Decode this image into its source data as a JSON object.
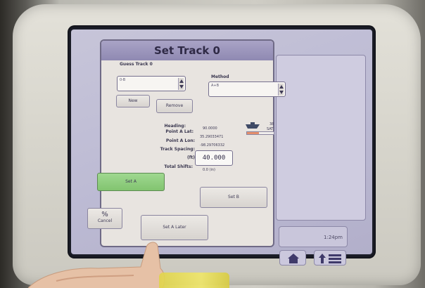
{
  "dialog": {
    "title": "Set Track 0",
    "guess_track_label": "Guess Track 0",
    "guess_track_value": "0-B",
    "method_label": "Method",
    "method_value": "A+B",
    "new_button": "New",
    "remove_button": "Remove",
    "heading_label": "Heading:",
    "heading_value": "90.0000",
    "point_a_lat_label": "Point A Lat:",
    "point_a_lat_value": "35.29033471",
    "point_a_lon_label": "Point A Lon:",
    "point_a_lon_value": "-98.29706332",
    "track_spacing_label": "Track Spacing:",
    "track_spacing_unit": "(ft)",
    "track_spacing_value": "40.000",
    "total_shifts_label": "Total Shifts:",
    "total_shifts_value": "0.0 (in)",
    "gauge_top_value": "38",
    "gauge_bottom_value": "SAT",
    "gauge_fill_fraction": 0.45,
    "set_a_button": "Set A",
    "set_b_button": "Set B",
    "set_a_later_button": "Set A Later",
    "cancel_button": "Cancel"
  },
  "status": {
    "clock": "1:24pm"
  },
  "icons": {
    "cancel": "cancel-percent-icon",
    "home": "home-icon",
    "menu": "up-arrow-menu-icon",
    "boat": "vehicle-icon"
  },
  "colors": {
    "set_a_green": "#92ce80",
    "gauge_fill": "#e58f6c",
    "title_bar": "#9a94bb"
  }
}
